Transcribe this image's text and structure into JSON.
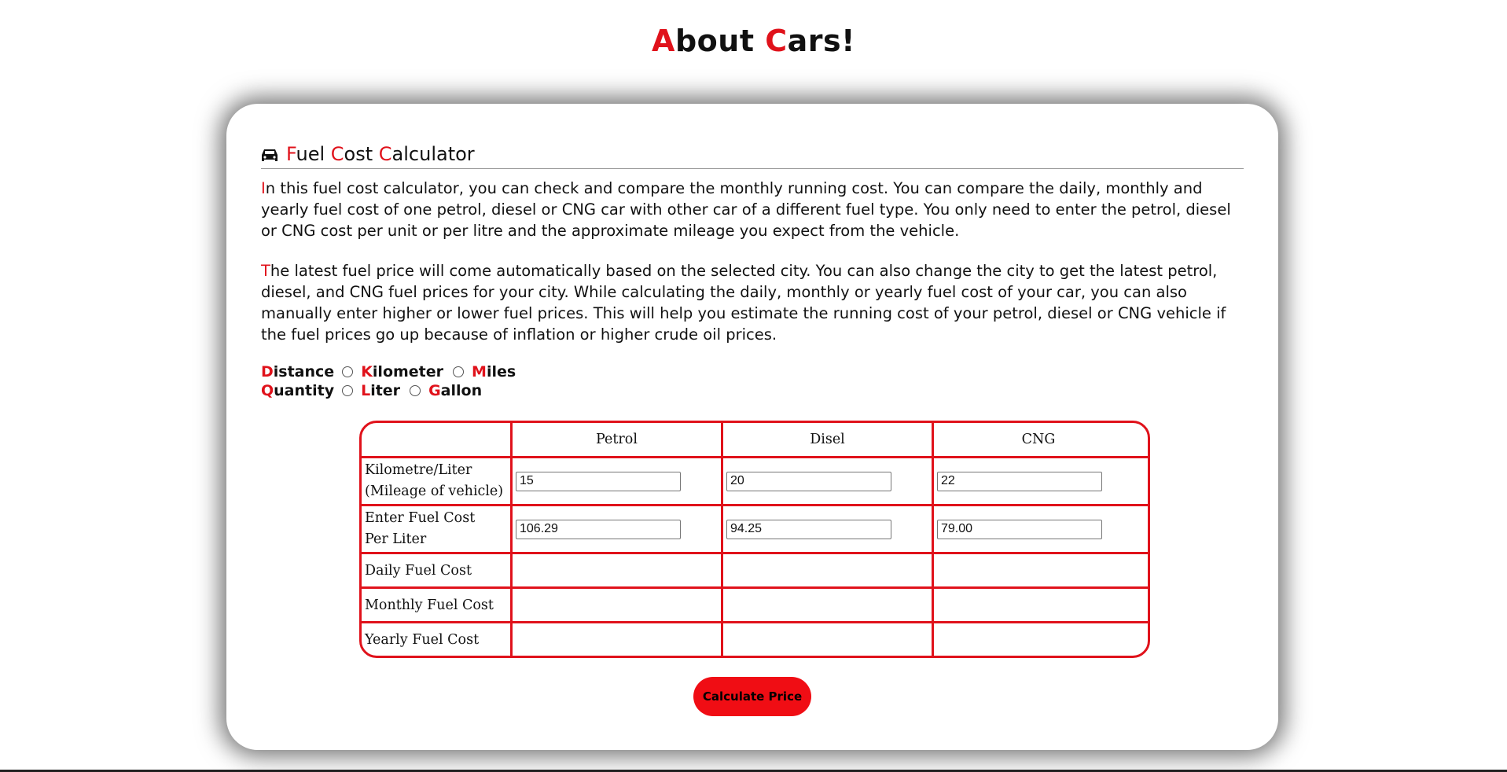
{
  "site_title": {
    "word1_initial": "A",
    "word1_rest": "bout ",
    "word2_initial": "C",
    "word2_rest": "ars!"
  },
  "calculator": {
    "heading": {
      "icon": "car-icon",
      "w1_initial": "F",
      "w1_rest": "uel ",
      "w2_initial": "C",
      "w2_rest": "ost ",
      "w3_initial": "C",
      "w3_rest": "alculator"
    },
    "paragraph1_initial": "I",
    "paragraph1_rest": "n this fuel cost calculator, you can check and compare the monthly running cost. You can compare the daily, monthly and yearly fuel cost of one petrol, diesel or CNG car with other car of a different fuel type. You only need to enter the petrol, diesel or CNG cost per unit or per litre and the approximate mileage you expect from the vehicle.",
    "paragraph2_initial": "T",
    "paragraph2_rest": "he latest fuel price will come automatically based on the selected city. You can also change the city to get the latest petrol, diesel, and CNG fuel prices for your city. While calculating the daily, monthly or yearly fuel cost of your car, you can also manually enter higher or lower fuel prices. This will help you estimate the running cost of your petrol, diesel or CNG vehicle if the fuel prices go up because of inflation or higher crude oil prices.",
    "distance": {
      "label_initial": "D",
      "label_rest": "istance",
      "opt1_initial": "K",
      "opt1_rest": "ilometer",
      "opt2_initial": "M",
      "opt2_rest": "iles"
    },
    "quantity": {
      "label_initial": "Q",
      "label_rest": "uantity",
      "opt1_initial": "L",
      "opt1_rest": "iter",
      "opt2_initial": "G",
      "opt2_rest": "allon"
    },
    "table": {
      "columns": [
        "",
        "Petrol",
        "Disel",
        "CNG"
      ],
      "mileage_label_line1": "Kilometre/Liter",
      "mileage_label_line2": "(Mileage of vehicle)",
      "mileage_values": [
        "15",
        "20",
        "22"
      ],
      "cost_label_line1": "Enter Fuel Cost",
      "cost_label_line2": "Per Liter",
      "cost_values": [
        "106.29",
        "94.25",
        "79.00"
      ],
      "daily_label": "Daily Fuel Cost",
      "monthly_label": "Monthly Fuel Cost",
      "yearly_label": "Yearly Fuel Cost"
    },
    "button_label": "Calculate Price"
  },
  "colors": {
    "accent": "#e0121b",
    "button": "#f00d14"
  }
}
